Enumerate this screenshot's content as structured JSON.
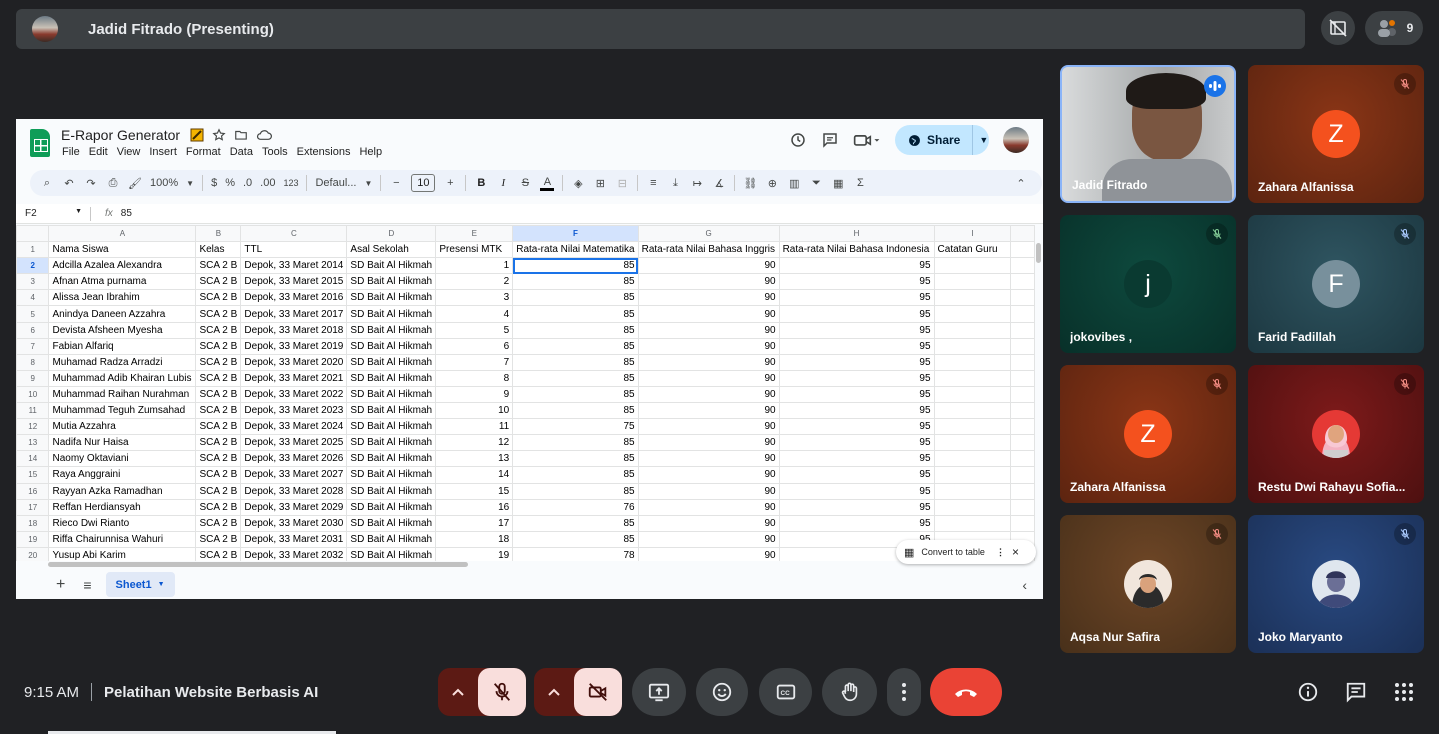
{
  "presenter": {
    "title": "Jadid Fitrado (Presenting)"
  },
  "participant_count": "9",
  "sheet": {
    "doc_title": "E-Rapor Generator",
    "menu": [
      "File",
      "Edit",
      "View",
      "Insert",
      "Format",
      "Data",
      "Tools",
      "Extensions",
      "Help"
    ],
    "share_label": "Share",
    "zoom": "100%",
    "currency": "$",
    "percent": "%",
    "dec_dec": ".0",
    "inc_dec": ".00",
    "format_123": "123",
    "font": "Defaul...",
    "font_size": "10",
    "cell_ref": "F2",
    "fx": "fx",
    "formula": "85",
    "col_letters": [
      "A",
      "B",
      "C",
      "D",
      "E",
      "F",
      "G",
      "H",
      "I"
    ],
    "headers": [
      "Nama Siswa",
      "Kelas",
      "TTL",
      "Asal Sekolah",
      "Presensi MTK",
      "Rata-rata Nilai Matematika",
      "Rata-rata Nilai Bahasa Inggris",
      "Rata-rata Nilai Bahasa Indonesia",
      "Catatan Guru"
    ],
    "rows": [
      [
        "Adcilla Azalea Alexandra",
        "SCA 2 B",
        "Depok, 33 Maret 2014",
        "SD Bait Al Hikmah",
        "1",
        "85",
        "90",
        "95",
        ""
      ],
      [
        "Afnan Atma purnama",
        "SCA 2 B",
        "Depok, 33 Maret 2015",
        "SD Bait Al Hikmah",
        "2",
        "85",
        "90",
        "95",
        ""
      ],
      [
        "Alissa Jean Ibrahim",
        "SCA 2 B",
        "Depok, 33 Maret 2016",
        "SD Bait Al Hikmah",
        "3",
        "85",
        "90",
        "95",
        ""
      ],
      [
        "Anindya Daneen Azzahra",
        "SCA 2 B",
        "Depok, 33 Maret 2017",
        "SD Bait Al Hikmah",
        "4",
        "85",
        "90",
        "95",
        ""
      ],
      [
        "Devista Afsheen Myesha",
        "SCA 2 B",
        "Depok, 33 Maret 2018",
        "SD Bait Al Hikmah",
        "5",
        "85",
        "90",
        "95",
        ""
      ],
      [
        "Fabian Alfariq",
        "SCA 2 B",
        "Depok, 33 Maret 2019",
        "SD Bait Al Hikmah",
        "6",
        "85",
        "90",
        "95",
        ""
      ],
      [
        "Muhamad Radza Arradzi",
        "SCA 2 B",
        "Depok, 33 Maret 2020",
        "SD Bait Al Hikmah",
        "7",
        "85",
        "90",
        "95",
        ""
      ],
      [
        "Muhammad Adib Khairan Lubis",
        "SCA 2 B",
        "Depok, 33 Maret 2021",
        "SD Bait Al Hikmah",
        "8",
        "85",
        "90",
        "95",
        ""
      ],
      [
        "Muhammad Raihan Nurahman",
        "SCA 2 B",
        "Depok, 33 Maret 2022",
        "SD Bait Al Hikmah",
        "9",
        "85",
        "90",
        "95",
        ""
      ],
      [
        "Muhammad Teguh Zumsahad",
        "SCA 2 B",
        "Depok, 33 Maret 2023",
        "SD Bait Al Hikmah",
        "10",
        "85",
        "90",
        "95",
        ""
      ],
      [
        "Mutia Azzahra",
        "SCA 2 B",
        "Depok, 33 Maret 2024",
        "SD Bait Al Hikmah",
        "11",
        "75",
        "90",
        "95",
        ""
      ],
      [
        "Nadifa Nur Haisa",
        "SCA 2 B",
        "Depok, 33 Maret 2025",
        "SD Bait Al Hikmah",
        "12",
        "85",
        "90",
        "95",
        ""
      ],
      [
        "Naomy Oktaviani",
        "SCA 2 B",
        "Depok, 33 Maret 2026",
        "SD Bait Al Hikmah",
        "13",
        "85",
        "90",
        "95",
        ""
      ],
      [
        "Raya Anggraini",
        "SCA 2 B",
        "Depok, 33 Maret 2027",
        "SD Bait Al Hikmah",
        "14",
        "85",
        "90",
        "95",
        ""
      ],
      [
        "Rayyan Azka Ramadhan",
        "SCA 2 B",
        "Depok, 33 Maret 2028",
        "SD Bait Al Hikmah",
        "15",
        "85",
        "90",
        "95",
        ""
      ],
      [
        "Reffan Herdiansyah",
        "SCA 2 B",
        "Depok, 33 Maret 2029",
        "SD Bait Al Hikmah",
        "16",
        "76",
        "90",
        "95",
        ""
      ],
      [
        "Rieco Dwi Rianto",
        "SCA 2 B",
        "Depok, 33 Maret 2030",
        "SD Bait Al Hikmah",
        "17",
        "85",
        "90",
        "95",
        ""
      ],
      [
        "Riffa Chairunnisa Wahuri",
        "SCA 2 B",
        "Depok, 33 Maret 2031",
        "SD Bait Al Hikmah",
        "18",
        "85",
        "90",
        "95",
        ""
      ],
      [
        "Yusup Abi Karim",
        "SCA 2 B",
        "Depok, 33 Maret 2032",
        "SD Bait Al Hikmah",
        "19",
        "78",
        "90",
        "95",
        ""
      ]
    ],
    "convert_label": "Convert to table",
    "sheet_tab": "Sheet1"
  },
  "participants": [
    {
      "name": "Jadid Fitrado",
      "initial": "",
      "bg": "#3a3d40",
      "speaking": true
    },
    {
      "name": "Zahara Alfanissa",
      "initial": "Z",
      "bg": "#7a2d14",
      "avatar_color": "#f4511e"
    },
    {
      "name": "jokovibes ,",
      "initial": "j",
      "bg": "#0b3d33",
      "avatar_color": "#0a4a3e"
    },
    {
      "name": "Farid Fadillah",
      "initial": "F",
      "bg": "#284550",
      "avatar_color": "#78909c"
    },
    {
      "name": "Zahara Alfanissa",
      "initial": "Z",
      "bg": "#7a2d14",
      "avatar_color": "#f4511e"
    },
    {
      "name": "Restu Dwi Rahayu Sofia...",
      "initial": "",
      "bg": "#6b1616"
    },
    {
      "name": "Aqsa Nur Safira",
      "initial": "",
      "bg": "#5d3a1e"
    },
    {
      "name": "Joko Maryanto",
      "initial": "",
      "bg": "#223b6b"
    }
  ],
  "meeting": {
    "time": "9:15 AM",
    "title": "Pelatihan Website Berbasis AI"
  },
  "colors": {
    "end_call": "#ea4335",
    "mic_off_bg": "#f9dedc",
    "accent": "#1a73e8"
  }
}
